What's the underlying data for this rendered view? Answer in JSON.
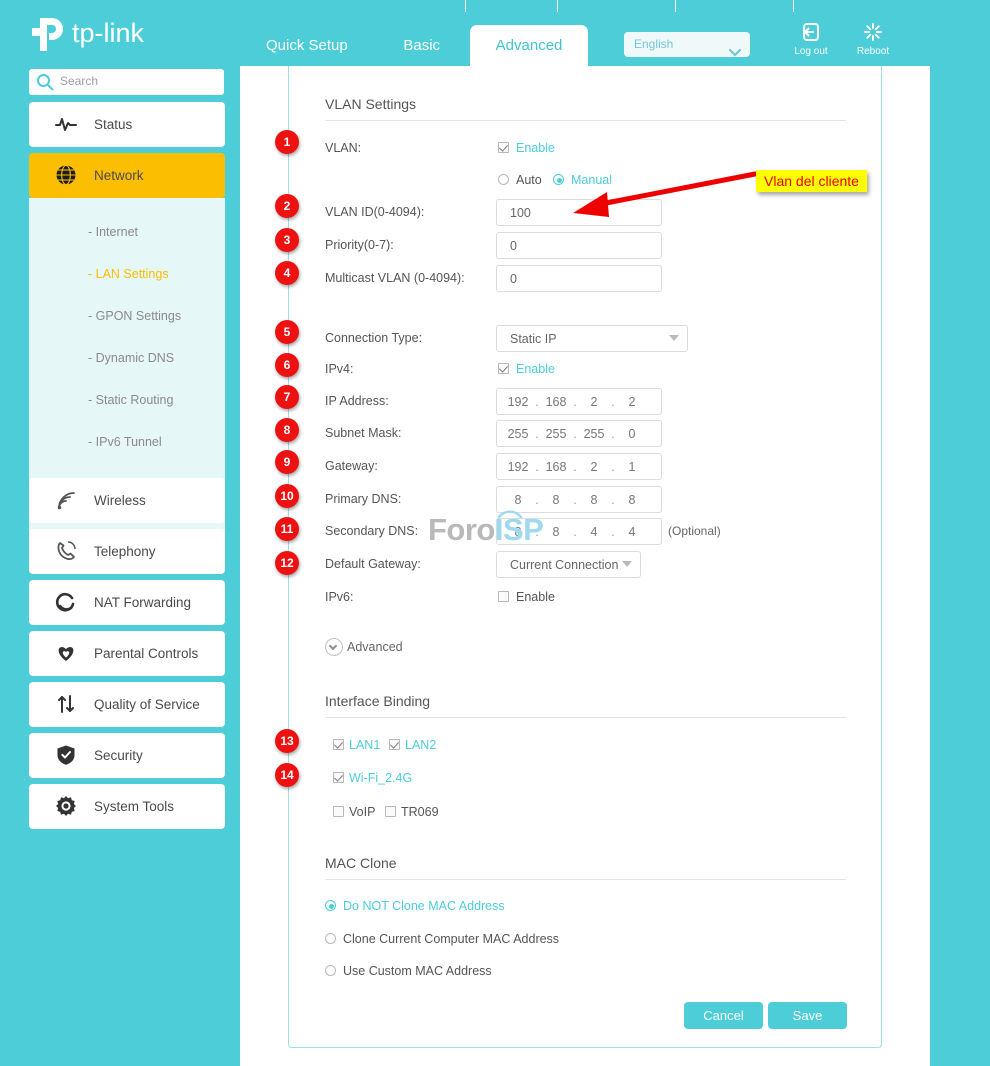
{
  "brand": {
    "name": "tp-link"
  },
  "header": {
    "tabs": [
      {
        "label": "Quick Setup",
        "active": false
      },
      {
        "label": "Basic",
        "active": false
      },
      {
        "label": "Advanced",
        "active": true
      }
    ],
    "language": {
      "value": "English"
    },
    "logout_label": "Log out",
    "reboot_label": "Reboot"
  },
  "sidebar": {
    "search_placeholder": "Search",
    "items": [
      {
        "label": "Status",
        "icon": "pulse-icon",
        "active": false
      },
      {
        "label": "Network",
        "icon": "globe-icon",
        "active": true
      }
    ],
    "subitems": [
      {
        "label": "- Internet",
        "active": false
      },
      {
        "label": "- LAN Settings",
        "active": true
      },
      {
        "label": "- GPON Settings",
        "active": false
      },
      {
        "label": "- Dynamic DNS",
        "active": false
      },
      {
        "label": "- Static Routing",
        "active": false
      },
      {
        "label": "- IPv6 Tunnel",
        "active": false
      }
    ],
    "items2": [
      {
        "label": "Wireless",
        "icon": "wifi-icon"
      },
      {
        "label": "Telephony",
        "icon": "phone-icon"
      },
      {
        "label": "NAT Forwarding",
        "icon": "nat-icon"
      },
      {
        "label": "Parental Controls",
        "icon": "heart-icon"
      },
      {
        "label": "Quality of Service",
        "icon": "arrows-icon"
      },
      {
        "label": "Security",
        "icon": "shield-icon"
      },
      {
        "label": "System Tools",
        "icon": "gear-icon"
      }
    ]
  },
  "vlan_section": {
    "title": "VLAN Settings",
    "vlan_label": "VLAN:",
    "vlan_enable_label": "Enable",
    "vlan_enable_checked": true,
    "mode_auto_label": "Auto",
    "mode_manual_label": "Manual",
    "mode_selected": "Manual",
    "vlan_id_label": "VLAN ID(0-4094):",
    "vlan_id_value": "100",
    "priority_label": "Priority(0-7):",
    "priority_value": "0",
    "multicast_label": "Multicast VLAN (0-4094):",
    "multicast_value": "0"
  },
  "connection_section": {
    "connection_type_label": "Connection Type:",
    "connection_type_value": "Static IP",
    "ipv4_label": "IPv4:",
    "ipv4_enable_label": "Enable",
    "ipv4_enable_checked": true,
    "ip_address_label": "IP Address:",
    "ip_address_octets": [
      "192",
      "168",
      "2",
      "2"
    ],
    "subnet_mask_label": "Subnet Mask:",
    "subnet_mask_octets": [
      "255",
      "255",
      "255",
      "0"
    ],
    "gateway_label": "Gateway:",
    "gateway_octets": [
      "192",
      "168",
      "2",
      "1"
    ],
    "primary_dns_label": "Primary DNS:",
    "primary_dns_octets": [
      "8",
      "8",
      "8",
      "8"
    ],
    "secondary_dns_label": "Secondary DNS:",
    "secondary_dns_octets": [
      "8",
      "8",
      "4",
      "4"
    ],
    "secondary_dns_hint": "(Optional)",
    "default_gateway_label": "Default Gateway:",
    "default_gateway_value": "Current Connection",
    "ipv6_label": "IPv6:",
    "ipv6_enable_label": "Enable",
    "ipv6_enable_checked": false,
    "advanced_label": "Advanced"
  },
  "interface_binding": {
    "title": "Interface Binding",
    "items": [
      {
        "label": "LAN1",
        "checked": true
      },
      {
        "label": "LAN2",
        "checked": true
      },
      {
        "label": "Wi-Fi_2.4G",
        "checked": true
      },
      {
        "label": "VoIP",
        "checked": false
      },
      {
        "label": "TR069",
        "checked": false
      }
    ]
  },
  "mac_clone": {
    "title": "MAC Clone",
    "options": [
      {
        "label": "Do NOT Clone MAC Address",
        "selected": true
      },
      {
        "label": "Clone Current Computer MAC Address",
        "selected": false
      },
      {
        "label": "Use Custom MAC Address",
        "selected": false
      }
    ]
  },
  "buttons": {
    "cancel_label": "Cancel",
    "save_label": "Save"
  },
  "annotations": {
    "callout_text": "Vlan del cliente",
    "badges": [
      "1",
      "2",
      "3",
      "4",
      "5",
      "6",
      "7",
      "8",
      "9",
      "10",
      "11",
      "12",
      "13",
      "14"
    ]
  },
  "watermark": {
    "part1": "Foro",
    "part2": "ISP"
  },
  "colors": {
    "teal": "#4ccdd8",
    "amber": "#fcbe00",
    "badge_red": "#ee1111",
    "callout_bg": "#ffff00",
    "callout_text": "#ee0000"
  }
}
